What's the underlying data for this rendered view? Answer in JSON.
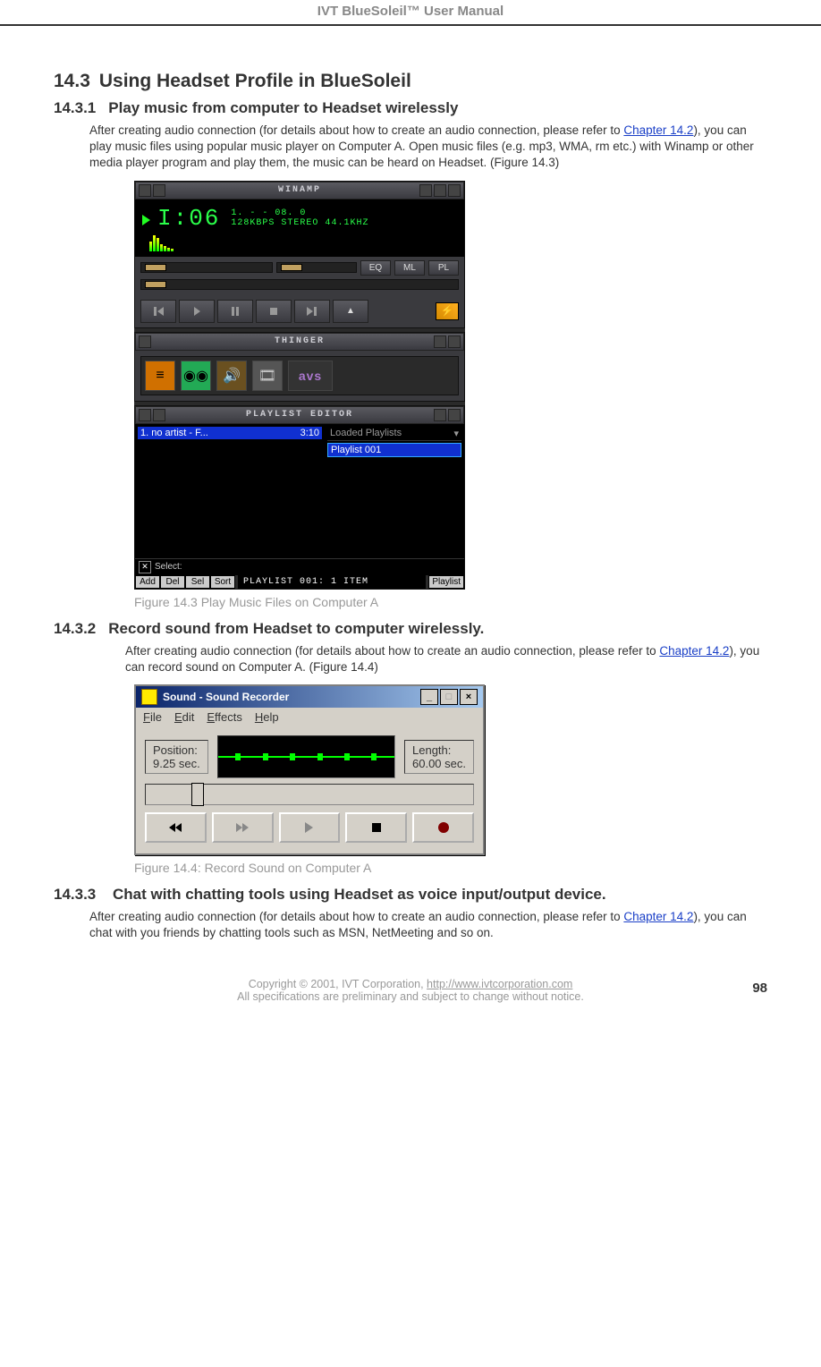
{
  "doc_header": "IVT BlueSoleil™ User Manual",
  "s14_3": {
    "num": "14.3",
    "title": "Using Headset Profile in BlueSoleil"
  },
  "s14_3_1": {
    "num": "14.3.1",
    "title": "Play music from computer to Headset wirelessly",
    "p_before": "After creating audio connection (for details about how to create an audio connection, please refer to ",
    "link": "Chapter 14.2",
    "p_after": "), you can play music files using popular music player on Computer A. Open music files (e.g. mp3, WMA, rm etc.) with Winamp or other media player program and play them, the music can be heard on Headset. (Figure 14.3)",
    "caption": "Figure 14.3 Play Music Files on Computer A"
  },
  "winamp": {
    "title": "WINAMP",
    "time": "I:06",
    "track": "1.   -   - 08. 0",
    "bitrate": "128KBPS STEREO 44.1KHZ",
    "eq": "EQ",
    "ml": "ML",
    "pl": "PL",
    "thinger": "THINGER",
    "avs": "avs",
    "playlist_title": "PLAYLIST  EDITOR",
    "pl_item_name": "1.  no artist - F...",
    "pl_item_time": "3:10",
    "loaded": "Loaded Playlists",
    "playlist001": "Playlist 001",
    "select_label": "Select:",
    "btn_add": "Add",
    "btn_del": "Del",
    "btn_sel": "Sel",
    "btn_sort": "Sort",
    "pl_status": "PLAYLIST 001: 1 ITEM",
    "btn_playlist": "Playlist"
  },
  "s14_3_2": {
    "num": "14.3.2",
    "title": "Record sound from Headset to computer wirelessly.",
    "p_before": "After creating audio connection (for details about how to create an audio connection, please refer to ",
    "link": "Chapter 14.2",
    "p_after": "), you can record sound on Computer A. (Figure 14.4)",
    "caption": "Figure 14.4: Record Sound on Computer A"
  },
  "recorder": {
    "title": "Sound - Sound Recorder",
    "menu_file": "File",
    "menu_edit": "Edit",
    "menu_effects": "Effects",
    "menu_help": "Help",
    "pos_label": "Position:",
    "pos_val": "9.25 sec.",
    "len_label": "Length:",
    "len_val": "60.00 sec."
  },
  "s14_3_3": {
    "num": "14.3.3",
    "title": " Chat with chatting tools using Headset as voice input/output device.",
    "p_before": "After creating audio connection (for details about how to create an audio connection,   please refer to ",
    "link": "Chapter 14.2",
    "p_after": "), you can chat with you friends by chatting tools such as MSN, NetMeeting and so on."
  },
  "footer": {
    "line1_a": "Copyright © 2001, IVT Corporation, ",
    "line1_link": "http://www.ivtcorporation.com",
    "line2": "All specifications are preliminary and subject to change without notice.",
    "pagenum": "98"
  }
}
